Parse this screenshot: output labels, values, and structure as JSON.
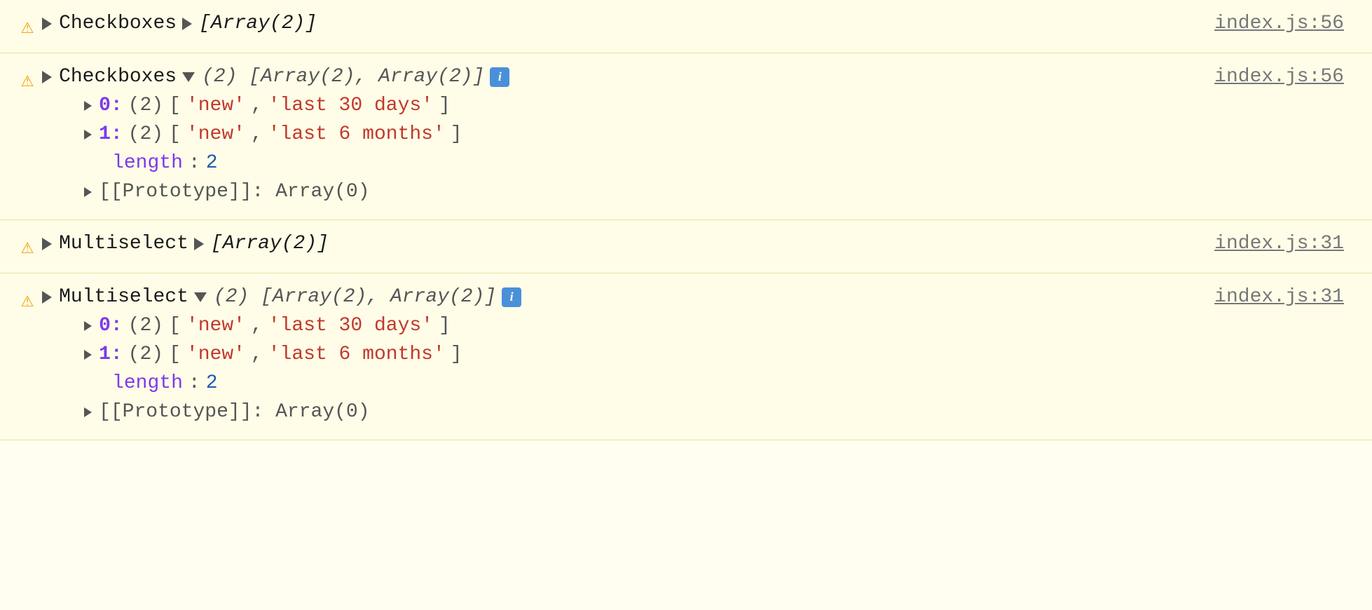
{
  "console": {
    "rows": [
      {
        "id": "row1",
        "warning": "⚠",
        "collapsed": true,
        "component": "Checkboxes",
        "summary": "[Array(2)]",
        "file_link": "index.js:56",
        "expanded_content": null
      },
      {
        "id": "row2",
        "warning": "⚠",
        "collapsed": false,
        "component": "Checkboxes",
        "summary": "(2) [Array(2), Array(2)]",
        "file_link": "index.js:56",
        "expanded_content": {
          "items": [
            {
              "index": "0",
              "count": "2",
              "values": [
                "'new'",
                "'last 30 days'"
              ]
            },
            {
              "index": "1",
              "count": "2",
              "values": [
                "'new'",
                "'last 6 months'"
              ]
            }
          ],
          "length_label": "length",
          "length_value": "2",
          "prototype_label": "[[Prototype]]",
          "prototype_value": "Array(0)"
        }
      },
      {
        "id": "row3",
        "warning": "⚠",
        "collapsed": true,
        "component": "Multiselect",
        "summary": "[Array(2)]",
        "file_link": "index.js:31",
        "expanded_content": null
      },
      {
        "id": "row4",
        "warning": "⚠",
        "collapsed": false,
        "component": "Multiselect",
        "summary": "(2) [Array(2), Array(2)]",
        "file_link": "index.js:31",
        "expanded_content": {
          "items": [
            {
              "index": "0",
              "count": "2",
              "values": [
                "'new'",
                "'last 30 days'"
              ]
            },
            {
              "index": "1",
              "count": "2",
              "values": [
                "'new'",
                "'last 6 months'"
              ]
            }
          ],
          "length_label": "length",
          "length_value": "2",
          "prototype_label": "[[Prototype]]",
          "prototype_value": "Array(0)"
        }
      }
    ]
  }
}
